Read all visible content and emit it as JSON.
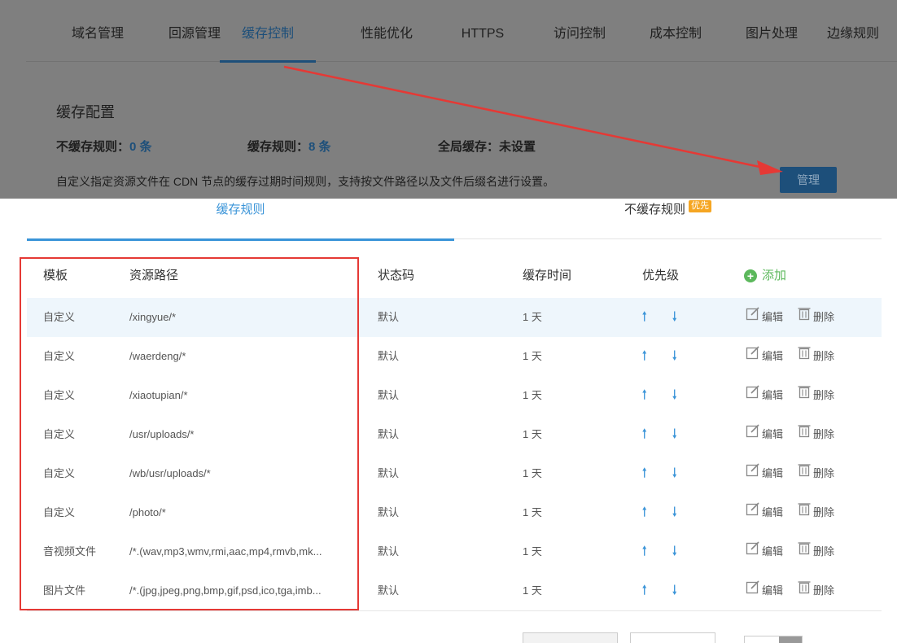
{
  "nav": {
    "items": [
      {
        "label": "域名管理",
        "active": false
      },
      {
        "label": "回源管理",
        "active": false
      },
      {
        "label": "缓存控制",
        "active": true
      },
      {
        "label": "性能优化",
        "active": false
      },
      {
        "label": "HTTPS",
        "active": false
      },
      {
        "label": "访问控制",
        "active": false
      },
      {
        "label": "成本控制",
        "active": false
      },
      {
        "label": "图片处理",
        "active": false
      },
      {
        "label": "边缘规则",
        "active": false
      }
    ]
  },
  "cache_config": {
    "title": "缓存配置",
    "no_cache_rules_label": "不缓存规则：",
    "no_cache_rules_count": "0 条",
    "cache_rules_label": "缓存规则：",
    "cache_rules_count": "8 条",
    "global_cache_label": "全局缓存：",
    "global_cache_value": "未设置",
    "description": "自定义指定资源文件在 CDN 节点的缓存过期时间规则，支持按文件路径以及文件后缀名进行设置。",
    "manage_label": "管理"
  },
  "tabs": {
    "cache_rules": "缓存规则",
    "no_cache_rules": "不缓存规则",
    "priority_badge": "优先"
  },
  "table": {
    "headers": {
      "template": "模板",
      "path": "资源路径",
      "status_code": "状态码",
      "cache_time": "缓存时间",
      "priority": "优先级",
      "add": "添加"
    },
    "edit_label": "编辑",
    "delete_label": "删除",
    "rows": [
      {
        "template": "自定义",
        "path": "/xingyue/*",
        "status_code": "默认",
        "cache_time": "1 天"
      },
      {
        "template": "自定义",
        "path": "/waerdeng/*",
        "status_code": "默认",
        "cache_time": "1 天"
      },
      {
        "template": "自定义",
        "path": "/xiaotupian/*",
        "status_code": "默认",
        "cache_time": "1 天"
      },
      {
        "template": "自定义",
        "path": "/usr/uploads/*",
        "status_code": "默认",
        "cache_time": "1 天"
      },
      {
        "template": "自定义",
        "path": "/wb/usr/uploads/*",
        "status_code": "默认",
        "cache_time": "1 天"
      },
      {
        "template": "自定义",
        "path": "/photo/*",
        "status_code": "默认",
        "cache_time": "1 天"
      },
      {
        "template": "音视频文件",
        "path": "/*.(wav,mp3,wmv,rmi,aac,mp4,rmvb,mk...",
        "status_code": "默认",
        "cache_time": "1 天"
      },
      {
        "template": "图片文件",
        "path": "/*.(jpg,jpeg,png,bmp,gif,psd,ico,tga,imb...",
        "status_code": "默认",
        "cache_time": "1 天"
      }
    ]
  },
  "colors": {
    "accent": "#3a94d8",
    "add_green": "#5cb85c",
    "annotation_red": "#e53935",
    "badge_orange": "#f5a623",
    "dimmed_overlay": "#7f7f7f"
  }
}
